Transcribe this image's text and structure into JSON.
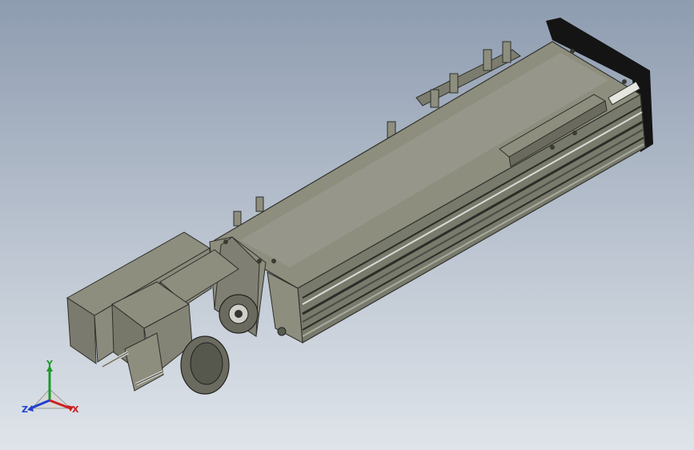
{
  "viewport": {
    "background_top": "#8e9cb0",
    "background_bottom": "#dfe4ea"
  },
  "model": {
    "body_color": "#8d8e7e",
    "shade_color": "#6a6b5e",
    "rail_color": "#c9ccc8"
  },
  "triad": {
    "x_label": "X",
    "y_label": "Y",
    "z_label": "Z",
    "x_color": "#cc2020",
    "y_color": "#1d9a2a",
    "z_color": "#2040d0"
  }
}
